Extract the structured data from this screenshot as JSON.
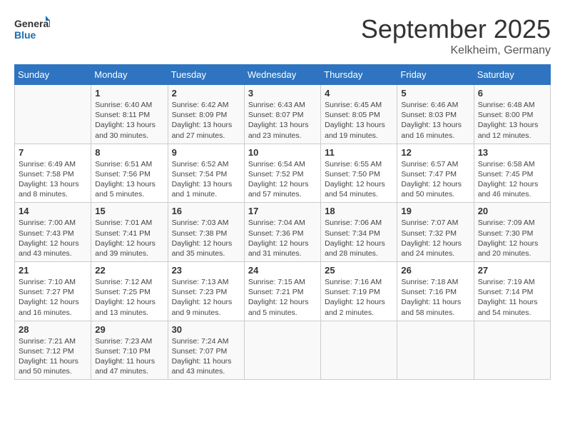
{
  "logo": {
    "line1": "General",
    "line2": "Blue"
  },
  "title": "September 2025",
  "subtitle": "Kelkheim, Germany",
  "days_of_week": [
    "Sunday",
    "Monday",
    "Tuesday",
    "Wednesday",
    "Thursday",
    "Friday",
    "Saturday"
  ],
  "weeks": [
    [
      {
        "day": "",
        "info": ""
      },
      {
        "day": "1",
        "info": "Sunrise: 6:40 AM\nSunset: 8:11 PM\nDaylight: 13 hours and 30 minutes."
      },
      {
        "day": "2",
        "info": "Sunrise: 6:42 AM\nSunset: 8:09 PM\nDaylight: 13 hours and 27 minutes."
      },
      {
        "day": "3",
        "info": "Sunrise: 6:43 AM\nSunset: 8:07 PM\nDaylight: 13 hours and 23 minutes."
      },
      {
        "day": "4",
        "info": "Sunrise: 6:45 AM\nSunset: 8:05 PM\nDaylight: 13 hours and 19 minutes."
      },
      {
        "day": "5",
        "info": "Sunrise: 6:46 AM\nSunset: 8:03 PM\nDaylight: 13 hours and 16 minutes."
      },
      {
        "day": "6",
        "info": "Sunrise: 6:48 AM\nSunset: 8:00 PM\nDaylight: 13 hours and 12 minutes."
      }
    ],
    [
      {
        "day": "7",
        "info": "Sunrise: 6:49 AM\nSunset: 7:58 PM\nDaylight: 13 hours and 8 minutes."
      },
      {
        "day": "8",
        "info": "Sunrise: 6:51 AM\nSunset: 7:56 PM\nDaylight: 13 hours and 5 minutes."
      },
      {
        "day": "9",
        "info": "Sunrise: 6:52 AM\nSunset: 7:54 PM\nDaylight: 13 hours and 1 minute."
      },
      {
        "day": "10",
        "info": "Sunrise: 6:54 AM\nSunset: 7:52 PM\nDaylight: 12 hours and 57 minutes."
      },
      {
        "day": "11",
        "info": "Sunrise: 6:55 AM\nSunset: 7:50 PM\nDaylight: 12 hours and 54 minutes."
      },
      {
        "day": "12",
        "info": "Sunrise: 6:57 AM\nSunset: 7:47 PM\nDaylight: 12 hours and 50 minutes."
      },
      {
        "day": "13",
        "info": "Sunrise: 6:58 AM\nSunset: 7:45 PM\nDaylight: 12 hours and 46 minutes."
      }
    ],
    [
      {
        "day": "14",
        "info": "Sunrise: 7:00 AM\nSunset: 7:43 PM\nDaylight: 12 hours and 43 minutes."
      },
      {
        "day": "15",
        "info": "Sunrise: 7:01 AM\nSunset: 7:41 PM\nDaylight: 12 hours and 39 minutes."
      },
      {
        "day": "16",
        "info": "Sunrise: 7:03 AM\nSunset: 7:38 PM\nDaylight: 12 hours and 35 minutes."
      },
      {
        "day": "17",
        "info": "Sunrise: 7:04 AM\nSunset: 7:36 PM\nDaylight: 12 hours and 31 minutes."
      },
      {
        "day": "18",
        "info": "Sunrise: 7:06 AM\nSunset: 7:34 PM\nDaylight: 12 hours and 28 minutes."
      },
      {
        "day": "19",
        "info": "Sunrise: 7:07 AM\nSunset: 7:32 PM\nDaylight: 12 hours and 24 minutes."
      },
      {
        "day": "20",
        "info": "Sunrise: 7:09 AM\nSunset: 7:30 PM\nDaylight: 12 hours and 20 minutes."
      }
    ],
    [
      {
        "day": "21",
        "info": "Sunrise: 7:10 AM\nSunset: 7:27 PM\nDaylight: 12 hours and 16 minutes."
      },
      {
        "day": "22",
        "info": "Sunrise: 7:12 AM\nSunset: 7:25 PM\nDaylight: 12 hours and 13 minutes."
      },
      {
        "day": "23",
        "info": "Sunrise: 7:13 AM\nSunset: 7:23 PM\nDaylight: 12 hours and 9 minutes."
      },
      {
        "day": "24",
        "info": "Sunrise: 7:15 AM\nSunset: 7:21 PM\nDaylight: 12 hours and 5 minutes."
      },
      {
        "day": "25",
        "info": "Sunrise: 7:16 AM\nSunset: 7:19 PM\nDaylight: 12 hours and 2 minutes."
      },
      {
        "day": "26",
        "info": "Sunrise: 7:18 AM\nSunset: 7:16 PM\nDaylight: 11 hours and 58 minutes."
      },
      {
        "day": "27",
        "info": "Sunrise: 7:19 AM\nSunset: 7:14 PM\nDaylight: 11 hours and 54 minutes."
      }
    ],
    [
      {
        "day": "28",
        "info": "Sunrise: 7:21 AM\nSunset: 7:12 PM\nDaylight: 11 hours and 50 minutes."
      },
      {
        "day": "29",
        "info": "Sunrise: 7:23 AM\nSunset: 7:10 PM\nDaylight: 11 hours and 47 minutes."
      },
      {
        "day": "30",
        "info": "Sunrise: 7:24 AM\nSunset: 7:07 PM\nDaylight: 11 hours and 43 minutes."
      },
      {
        "day": "",
        "info": ""
      },
      {
        "day": "",
        "info": ""
      },
      {
        "day": "",
        "info": ""
      },
      {
        "day": "",
        "info": ""
      }
    ]
  ]
}
